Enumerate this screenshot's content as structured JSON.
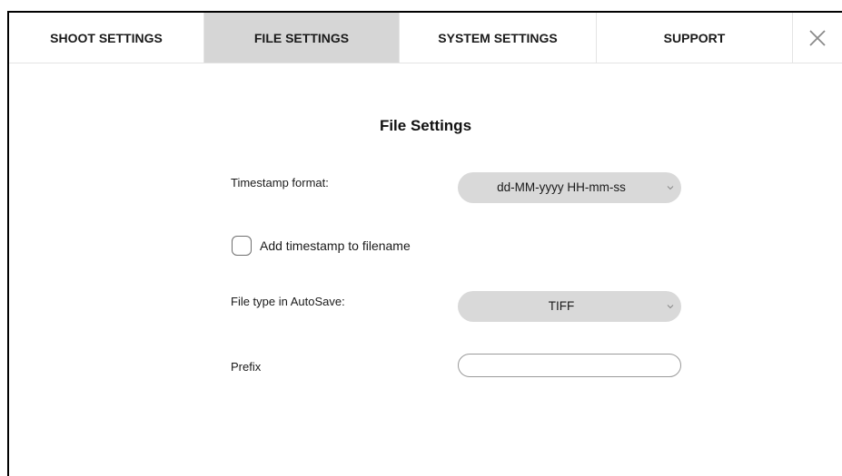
{
  "tabs": [
    {
      "label": "SHOOT SETTINGS",
      "active": false
    },
    {
      "label": "FILE SETTINGS",
      "active": true
    },
    {
      "label": "SYSTEM SETTINGS",
      "active": false
    },
    {
      "label": "SUPPORT",
      "active": false
    }
  ],
  "close_icon": "close-x-icon",
  "colors": {
    "active_tab_bg": "#d6d6d6",
    "select_bg": "#d9d9d9",
    "divider": "#e4e4e4"
  },
  "panel": {
    "title": "File Settings",
    "timestamp_format": {
      "label": "Timestamp format:",
      "value": "dd-MM-yyyy HH-mm-ss"
    },
    "add_timestamp": {
      "label": "Add timestamp to filename",
      "checked": false
    },
    "file_type": {
      "label": "File type in AutoSave:",
      "value": "TIFF"
    },
    "prefix": {
      "label": "Prefix",
      "value": "",
      "placeholder": ""
    }
  }
}
